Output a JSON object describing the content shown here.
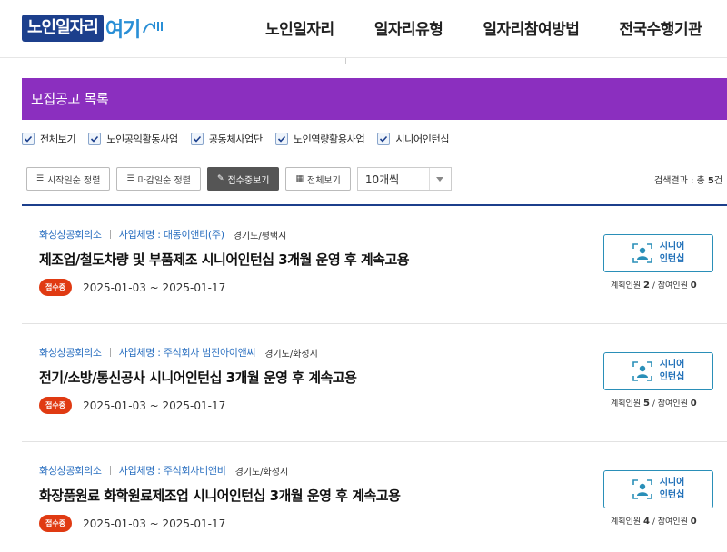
{
  "header": {
    "logo_main": "노인일자리",
    "logo_sub": "여기",
    "nav": [
      "노인일자리",
      "일자리유형",
      "일자리참여방법",
      "전국수행기관"
    ]
  },
  "banner": {
    "title": "모집공고 목록"
  },
  "filters": [
    {
      "label": "전체보기",
      "checked": true
    },
    {
      "label": "노인공익활동사업",
      "checked": true
    },
    {
      "label": "공동체사업단",
      "checked": true
    },
    {
      "label": "노인역량활용사업",
      "checked": true
    },
    {
      "label": "시니어인턴십",
      "checked": true
    }
  ],
  "controls": {
    "sort_start": "시작일순 정렬",
    "sort_end": "마감일순 정렬",
    "receiving": "접수중보기",
    "all": "전체보기",
    "page_size": "10개씩",
    "result_prefix": "검색결과 : 총 ",
    "result_count": "5",
    "result_suffix": "건"
  },
  "jobs": [
    {
      "org": "화성상공회의소",
      "company": "사업체명 : 대동이앤티(주)",
      "region": "경기도/평택시",
      "title": "제조업/철도차량 및 부품제조 시니어인턴십 3개월 운영 후 계속고용",
      "status": "접수중",
      "dates": "2025-01-03 ~ 2025-01-17",
      "type_line1": "시니어",
      "type_line2": "인턴십",
      "plan_label": "계획인원",
      "plan": "2",
      "join_label": "참여인원",
      "join": "0"
    },
    {
      "org": "화성상공회의소",
      "company": "사업체명 : 주식회사 범진아이앤씨",
      "region": "경기도/화성시",
      "title": "전기/소방/통신공사 시니어인턴십 3개월 운영 후 계속고용",
      "status": "접수중",
      "dates": "2025-01-03 ~ 2025-01-17",
      "type_line1": "시니어",
      "type_line2": "인턴십",
      "plan_label": "계획인원",
      "plan": "5",
      "join_label": "참여인원",
      "join": "0"
    },
    {
      "org": "화성상공회의소",
      "company": "사업체명 : 주식회사비앤비",
      "region": "경기도/화성시",
      "title": "화장품원료 화학원료제조업 시니어인턴십 3개월 운영 후 계속고용",
      "status": "접수중",
      "dates": "2025-01-03 ~ 2025-01-17",
      "type_line1": "시니어",
      "type_line2": "인턴십",
      "plan_label": "계획인원",
      "plan": "4",
      "join_label": "참여인원",
      "join": "0"
    }
  ],
  "colors": {
    "banner": "#8b2fbf",
    "status": "#e03a12",
    "accent": "#2a6fc0",
    "navy": "#1c3f8c"
  }
}
